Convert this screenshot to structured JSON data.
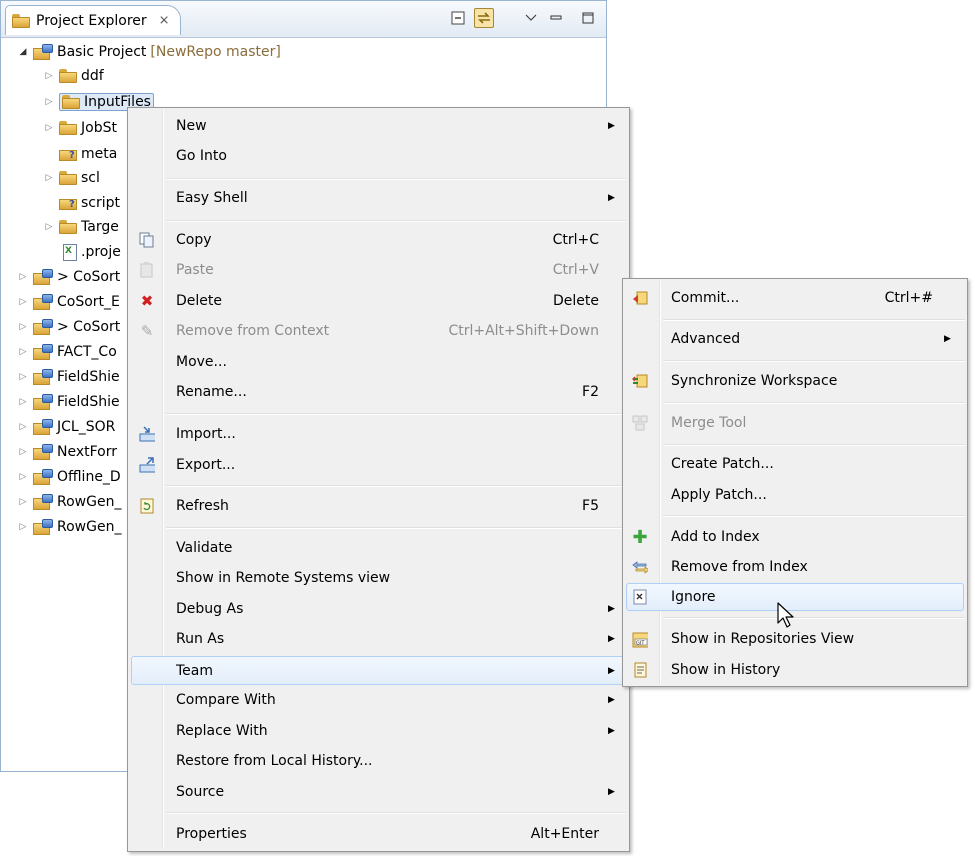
{
  "explorer": {
    "title": "Project Explorer",
    "close_glyph": "⨯",
    "header_buttons": [
      "collapse-all-icon",
      "link-with-editor-icon",
      "view-menu-icon",
      "minimize-icon",
      "maximize-icon"
    ],
    "root": {
      "name": "Basic Project",
      "decoration": "[NewRepo master]"
    },
    "children": [
      {
        "label": "ddf",
        "icon": "folder-icon",
        "expandable": true
      },
      {
        "label": "InputFiles",
        "icon": "folder-icon",
        "expandable": true,
        "selected": true
      },
      {
        "label": "JobSt",
        "icon": "folder-icon",
        "expandable": true
      },
      {
        "label": "meta",
        "icon": "untracked-folder-icon",
        "expandable": false
      },
      {
        "label": "scl",
        "icon": "folder-icon",
        "expandable": true
      },
      {
        "label": "script",
        "icon": "untracked-folder-icon",
        "expandable": false
      },
      {
        "label": "Targe",
        "icon": "folder-icon",
        "expandable": true
      },
      {
        "label": ".proje",
        "icon": "xml-file-icon",
        "expandable": false
      }
    ],
    "projects": [
      "> CoSort",
      "CoSort_E",
      "> CoSort",
      "FACT_Co",
      "FieldShie",
      "FieldShie",
      "JCL_SOR",
      "NextForr",
      "Offline_D",
      "RowGen_",
      "RowGen_"
    ]
  },
  "context_menu": {
    "items": [
      {
        "label": "New",
        "submenu": true
      },
      {
        "label": "Go Into"
      },
      {
        "sep": true
      },
      {
        "label": "Easy Shell",
        "submenu": true
      },
      {
        "sep": true
      },
      {
        "label": "Copy",
        "accel": "Ctrl+C",
        "icon": "copy-icon"
      },
      {
        "label": "Paste",
        "accel": "Ctrl+V",
        "icon": "paste-icon",
        "disabled": true
      },
      {
        "label": "Delete",
        "accel": "Delete",
        "icon": "delete-icon"
      },
      {
        "label": "Remove from Context",
        "accel": "Ctrl+Alt+Shift+Down",
        "icon": "remove-context-icon",
        "disabled": true
      },
      {
        "label": "Move..."
      },
      {
        "label": "Rename...",
        "accel": "F2"
      },
      {
        "sep": true
      },
      {
        "label": "Import...",
        "icon": "import-icon"
      },
      {
        "label": "Export...",
        "icon": "export-icon"
      },
      {
        "sep": true
      },
      {
        "label": "Refresh",
        "accel": "F5",
        "icon": "refresh-icon"
      },
      {
        "sep": true
      },
      {
        "label": "Validate"
      },
      {
        "label": "Show in Remote Systems view"
      },
      {
        "label": "Debug As",
        "submenu": true
      },
      {
        "label": "Run As",
        "submenu": true
      },
      {
        "label": "Team",
        "submenu": true,
        "highlighted": true
      },
      {
        "label": "Compare With",
        "submenu": true
      },
      {
        "label": "Replace With",
        "submenu": true
      },
      {
        "label": "Restore from Local History..."
      },
      {
        "label": "Source",
        "submenu": true
      },
      {
        "sep": true
      },
      {
        "label": "Properties",
        "accel": "Alt+Enter"
      }
    ]
  },
  "team_menu": {
    "items": [
      {
        "label": "Commit...",
        "accel": "Ctrl+#",
        "icon": "commit-icon"
      },
      {
        "sep": true
      },
      {
        "label": "Advanced",
        "submenu": true
      },
      {
        "sep": true
      },
      {
        "label": "Synchronize Workspace",
        "icon": "synchronize-icon"
      },
      {
        "sep": true
      },
      {
        "label": "Merge Tool",
        "icon": "merge-tool-icon",
        "disabled": true
      },
      {
        "sep": true
      },
      {
        "label": "Create Patch..."
      },
      {
        "label": "Apply Patch..."
      },
      {
        "sep": true
      },
      {
        "label": "Add to Index",
        "icon": "add-to-index-icon"
      },
      {
        "label": "Remove from Index",
        "icon": "remove-from-index-icon"
      },
      {
        "label": "Ignore",
        "icon": "ignore-icon",
        "highlighted": true
      },
      {
        "sep": true
      },
      {
        "label": "Show in Repositories View",
        "icon": "git-repositories-icon"
      },
      {
        "label": "Show in History",
        "icon": "history-icon"
      }
    ]
  },
  "colors": {
    "menu_bg": "#f0f0f0",
    "highlight_border": "#aecff7",
    "decoration": "#8a6d3b",
    "delete_red": "#d21f1f",
    "add_green": "#3aa53a"
  }
}
